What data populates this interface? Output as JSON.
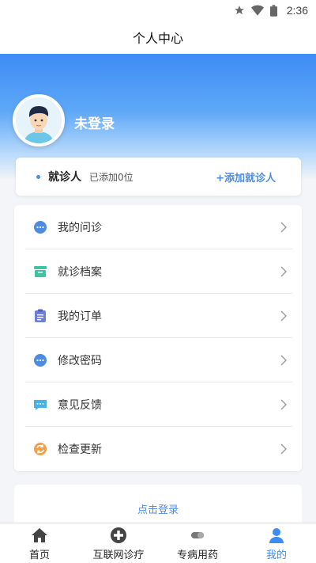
{
  "status_bar": {
    "time": "2:36"
  },
  "title": "个人中心",
  "user": {
    "name": "未登录"
  },
  "patient": {
    "label": "就诊人",
    "count": "已添加0位",
    "add": "+添加就诊人"
  },
  "menu": [
    {
      "label": "我的问诊",
      "icon": "chat-bubble-icon",
      "color": "#4d8ce0"
    },
    {
      "label": "就诊档案",
      "icon": "archive-box-icon",
      "color": "#3cc6a0"
    },
    {
      "label": "我的订单",
      "icon": "clipboard-list-icon",
      "color": "#6f7fd6"
    },
    {
      "label": "修改密码",
      "icon": "chat-dots-icon",
      "color": "#4d8ce0"
    },
    {
      "label": "意见反馈",
      "icon": "feedback-message-icon",
      "color": "#47b2e8"
    },
    {
      "label": "检查更新",
      "icon": "refresh-update-icon",
      "color": "#f0a04a"
    }
  ],
  "login_prompt": "点击登录",
  "nav": [
    {
      "label": "首页",
      "icon": "home-icon"
    },
    {
      "label": "互联网诊疗",
      "icon": "medical-cross-icon"
    },
    {
      "label": "专病用药",
      "icon": "medicine-icon"
    },
    {
      "label": "我的",
      "icon": "profile-icon"
    }
  ],
  "colors": {
    "accent": "#3d8cf5",
    "link": "#4d8ce0"
  }
}
